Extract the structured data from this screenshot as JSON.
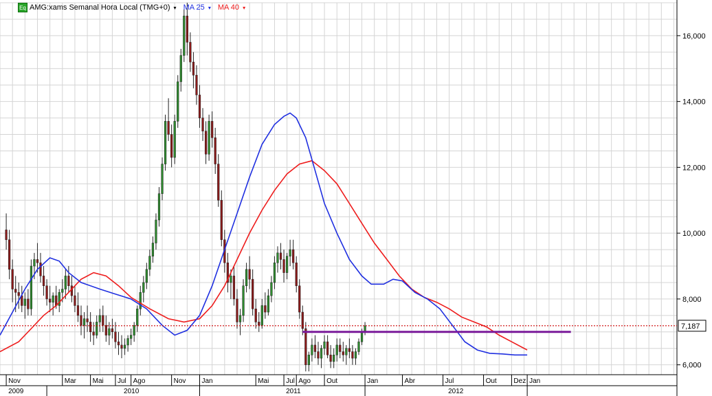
{
  "header": {
    "badge": "Eq",
    "symbol_label": "AMG:xams Semanal Hora Local (TMG+0)",
    "ma25_label": "MA 25",
    "ma40_label": "MA 40",
    "dropdown_glyph": "▾"
  },
  "colors": {
    "background": "#ffffff",
    "grid": "#d4d4d4",
    "ma25": "#1f2fe0",
    "ma40": "#ee1c1c",
    "support_line": "#7a1a9a",
    "last_price_line": "#cc0000",
    "candle_up": "#2e8b2e",
    "candle_down": "#8b1a1a"
  },
  "chart_data": {
    "type": "candlestick",
    "title": "AMG:xams Semanal Hora Local (TMG+0)",
    "y_axis": {
      "ticks": [
        "6,000",
        "8,000",
        "10,000",
        "12,000",
        "14,000",
        "16,000"
      ],
      "tick_values": [
        6000,
        8000,
        10000,
        12000,
        14000,
        16000
      ],
      "ylim": [
        5700,
        17000
      ]
    },
    "x_axis": {
      "month_ticks": [
        {
          "label": "Nov",
          "week": 0
        },
        {
          "label": "Mar",
          "week": 18
        },
        {
          "label": "Mai",
          "week": 27
        },
        {
          "label": "Jul",
          "week": 35
        },
        {
          "label": "Ago",
          "week": 40
        },
        {
          "label": "Nov",
          "week": 53
        },
        {
          "label": "Jan",
          "week": 62
        },
        {
          "label": "Mai",
          "week": 80
        },
        {
          "label": "Jul",
          "week": 89
        },
        {
          "label": "Ago",
          "week": 93
        },
        {
          "label": "Out",
          "week": 102
        },
        {
          "label": "Jan",
          "week": 115
        },
        {
          "label": "Abr",
          "week": 127
        },
        {
          "label": "Jul",
          "week": 140
        },
        {
          "label": "Out",
          "week": 153
        },
        {
          "label": "Dez",
          "week": 162
        },
        {
          "label": "Jan",
          "week": 167
        }
      ],
      "year_ticks": [
        {
          "label": "2009",
          "week": 0
        },
        {
          "label": "2010",
          "week": 37
        },
        {
          "label": "2011",
          "week": 89
        },
        {
          "label": "2012",
          "week": 141
        }
      ],
      "year_boundaries": [
        13,
        62,
        115,
        167
      ],
      "week_range": [
        -2,
        215
      ]
    },
    "last_price": {
      "value": 7187,
      "label": "7,187"
    },
    "support_line": {
      "value": 7000,
      "from_week": 95,
      "to_week": 181
    },
    "ma25_points": [
      [
        -2,
        6900
      ],
      [
        2,
        7600
      ],
      [
        6,
        8300
      ],
      [
        10,
        8900
      ],
      [
        14,
        9250
      ],
      [
        17,
        9150
      ],
      [
        20,
        8800
      ],
      [
        24,
        8500
      ],
      [
        30,
        8300
      ],
      [
        35,
        8150
      ],
      [
        40,
        8000
      ],
      [
        45,
        7700
      ],
      [
        50,
        7200
      ],
      [
        54,
        6900
      ],
      [
        58,
        7050
      ],
      [
        62,
        7500
      ],
      [
        66,
        8400
      ],
      [
        70,
        9500
      ],
      [
        74,
        10600
      ],
      [
        78,
        11700
      ],
      [
        82,
        12700
      ],
      [
        86,
        13300
      ],
      [
        89,
        13550
      ],
      [
        91,
        13650
      ],
      [
        93,
        13500
      ],
      [
        96,
        12900
      ],
      [
        99,
        11900
      ],
      [
        102,
        10900
      ],
      [
        106,
        10000
      ],
      [
        110,
        9200
      ],
      [
        114,
        8700
      ],
      [
        117,
        8450
      ],
      [
        121,
        8450
      ],
      [
        124,
        8600
      ],
      [
        127,
        8550
      ],
      [
        131,
        8200
      ],
      [
        135,
        8000
      ],
      [
        139,
        7700
      ],
      [
        143,
        7200
      ],
      [
        147,
        6700
      ],
      [
        151,
        6450
      ],
      [
        155,
        6350
      ],
      [
        159,
        6330
      ],
      [
        163,
        6300
      ],
      [
        167,
        6300
      ]
    ],
    "ma40_points": [
      [
        -2,
        6400
      ],
      [
        4,
        6700
      ],
      [
        8,
        7100
      ],
      [
        12,
        7500
      ],
      [
        16,
        7800
      ],
      [
        20,
        8200
      ],
      [
        24,
        8600
      ],
      [
        28,
        8800
      ],
      [
        32,
        8700
      ],
      [
        36,
        8400
      ],
      [
        40,
        8050
      ],
      [
        46,
        7700
      ],
      [
        52,
        7400
      ],
      [
        57,
        7300
      ],
      [
        62,
        7400
      ],
      [
        66,
        7800
      ],
      [
        70,
        8400
      ],
      [
        74,
        9200
      ],
      [
        78,
        10000
      ],
      [
        82,
        10700
      ],
      [
        86,
        11300
      ],
      [
        90,
        11800
      ],
      [
        94,
        12100
      ],
      [
        98,
        12200
      ],
      [
        102,
        11900
      ],
      [
        106,
        11500
      ],
      [
        110,
        10900
      ],
      [
        114,
        10300
      ],
      [
        118,
        9700
      ],
      [
        122,
        9200
      ],
      [
        126,
        8700
      ],
      [
        130,
        8300
      ],
      [
        134,
        8050
      ],
      [
        138,
        7900
      ],
      [
        142,
        7700
      ],
      [
        146,
        7450
      ],
      [
        150,
        7300
      ],
      [
        154,
        7150
      ],
      [
        158,
        6900
      ],
      [
        162,
        6700
      ],
      [
        167,
        6450
      ]
    ],
    "candles": [
      [
        10100,
        10600,
        9500,
        9800
      ],
      [
        9800,
        10100,
        8600,
        8900
      ],
      [
        8900,
        9200,
        7900,
        8300
      ],
      [
        8300,
        8700,
        7600,
        8200
      ],
      [
        8200,
        8500,
        7700,
        8100
      ],
      [
        8100,
        8400,
        7600,
        7800
      ],
      [
        7800,
        8200,
        7400,
        8000
      ],
      [
        8000,
        8300,
        7500,
        7700
      ],
      [
        7700,
        9200,
        7500,
        9000
      ],
      [
        9000,
        9400,
        8600,
        9200
      ],
      [
        9200,
        9700,
        8800,
        9100
      ],
      [
        9100,
        9400,
        8500,
        8700
      ],
      [
        8700,
        9000,
        8100,
        8400
      ],
      [
        8400,
        8600,
        7800,
        8000
      ],
      [
        8000,
        8400,
        7600,
        7900
      ],
      [
        7900,
        8200,
        7500,
        8100
      ],
      [
        8100,
        8400,
        7700,
        7800
      ],
      [
        7800,
        8300,
        7600,
        8200
      ],
      [
        8200,
        8600,
        7900,
        8300
      ],
      [
        8300,
        8900,
        8000,
        8700
      ],
      [
        8700,
        9000,
        8200,
        8400
      ],
      [
        8400,
        8700,
        7900,
        8100
      ],
      [
        8100,
        8400,
        7600,
        7800
      ],
      [
        7800,
        8200,
        7300,
        7500
      ],
      [
        7500,
        7800,
        6900,
        7200
      ],
      [
        7200,
        7600,
        6800,
        7400
      ],
      [
        7400,
        7800,
        7000,
        7300
      ],
      [
        7300,
        7600,
        6700,
        7000
      ],
      [
        7000,
        7300,
        6600,
        6900
      ],
      [
        6900,
        7500,
        6800,
        7300
      ],
      [
        7300,
        7700,
        7000,
        7500
      ],
      [
        7500,
        7800,
        7000,
        7200
      ],
      [
        7200,
        7500,
        6700,
        6900
      ],
      [
        6900,
        7300,
        6600,
        7100
      ],
      [
        7100,
        7400,
        6800,
        7000
      ],
      [
        7000,
        7300,
        6500,
        6700
      ],
      [
        6700,
        7000,
        6300,
        6600
      ],
      [
        6600,
        6900,
        6200,
        6500
      ],
      [
        6500,
        6800,
        6300,
        6600
      ],
      [
        6600,
        6900,
        6400,
        6800
      ],
      [
        6800,
        7100,
        6600,
        6900
      ],
      [
        6900,
        7300,
        6700,
        7200
      ],
      [
        7200,
        7800,
        7000,
        7700
      ],
      [
        7700,
        8400,
        7500,
        8200
      ],
      [
        8200,
        8700,
        7900,
        8500
      ],
      [
        8500,
        9100,
        8300,
        8900
      ],
      [
        8900,
        9500,
        8700,
        9300
      ],
      [
        9300,
        9900,
        9100,
        9700
      ],
      [
        9700,
        10600,
        9500,
        10400
      ],
      [
        10400,
        11400,
        10200,
        11200
      ],
      [
        11200,
        12300,
        11000,
        12100
      ],
      [
        12100,
        13600,
        11900,
        13400
      ],
      [
        13400,
        14100,
        12800,
        13000
      ],
      [
        13000,
        13300,
        12000,
        12300
      ],
      [
        12300,
        13600,
        12100,
        13400
      ],
      [
        13400,
        14800,
        13200,
        14600
      ],
      [
        14600,
        15600,
        14300,
        15400
      ],
      [
        15400,
        16800,
        15200,
        16600
      ],
      [
        16600,
        17000,
        15400,
        15800
      ],
      [
        15800,
        16100,
        14900,
        15200
      ],
      [
        15200,
        15500,
        14400,
        14800
      ],
      [
        14800,
        15100,
        13900,
        14200
      ],
      [
        14200,
        14500,
        13200,
        13500
      ],
      [
        13500,
        13800,
        12800,
        13100
      ],
      [
        13100,
        13400,
        12100,
        12400
      ],
      [
        12400,
        13600,
        12200,
        13400
      ],
      [
        13400,
        13700,
        12600,
        12900
      ],
      [
        12900,
        13200,
        11800,
        12100
      ],
      [
        12100,
        12400,
        10800,
        11000
      ],
      [
        11000,
        11300,
        9600,
        9800
      ],
      [
        9800,
        10100,
        8800,
        9100
      ],
      [
        9100,
        9400,
        8200,
        8500
      ],
      [
        8500,
        8900,
        8000,
        8700
      ],
      [
        8700,
        9000,
        7800,
        8000
      ],
      [
        8000,
        8300,
        7100,
        7300
      ],
      [
        7300,
        7700,
        6900,
        7500
      ],
      [
        7500,
        8600,
        7300,
        8400
      ],
      [
        8400,
        9100,
        8200,
        8900
      ],
      [
        8900,
        9300,
        8300,
        8600
      ],
      [
        8600,
        8900,
        7500,
        7700
      ],
      [
        7700,
        8000,
        7100,
        7300
      ],
      [
        7300,
        7600,
        7000,
        7200
      ],
      [
        7200,
        8000,
        7100,
        7800
      ],
      [
        7800,
        8200,
        7400,
        7600
      ],
      [
        7600,
        8300,
        7500,
        8100
      ],
      [
        8100,
        8700,
        7900,
        8500
      ],
      [
        8500,
        9300,
        8300,
        9100
      ],
      [
        9100,
        9600,
        8800,
        9400
      ],
      [
        9400,
        9700,
        8900,
        9200
      ],
      [
        9200,
        9500,
        8500,
        8800
      ],
      [
        8800,
        9400,
        8600,
        9300
      ],
      [
        9300,
        9800,
        9000,
        9500
      ],
      [
        9500,
        9800,
        8900,
        9100
      ],
      [
        9100,
        9300,
        8200,
        8400
      ],
      [
        8400,
        8600,
        7400,
        7600
      ],
      [
        7600,
        7800,
        6900,
        7100
      ],
      [
        7100,
        7300,
        5800,
        6000
      ],
      [
        6000,
        6400,
        5800,
        6300
      ],
      [
        6300,
        6800,
        6100,
        6600
      ],
      [
        6600,
        6900,
        6200,
        6400
      ],
      [
        6400,
        6700,
        6000,
        6200
      ],
      [
        6200,
        6600,
        5900,
        6500
      ],
      [
        6500,
        6900,
        6300,
        6700
      ],
      [
        6700,
        6900,
        6200,
        6300
      ],
      [
        6300,
        6600,
        5900,
        6100
      ],
      [
        6100,
        6500,
        5900,
        6300
      ],
      [
        6300,
        6800,
        6100,
        6600
      ],
      [
        6600,
        6800,
        6200,
        6400
      ],
      [
        6400,
        6700,
        6100,
        6300
      ],
      [
        6300,
        6600,
        6000,
        6500
      ],
      [
        6500,
        6800,
        6200,
        6400
      ],
      [
        6400,
        6600,
        6000,
        6200
      ],
      [
        6200,
        6500,
        6000,
        6400
      ],
      [
        6400,
        6800,
        6300,
        6700
      ],
      [
        6700,
        7100,
        6600,
        7000
      ],
      [
        7000,
        7300,
        6900,
        7187
      ]
    ]
  }
}
